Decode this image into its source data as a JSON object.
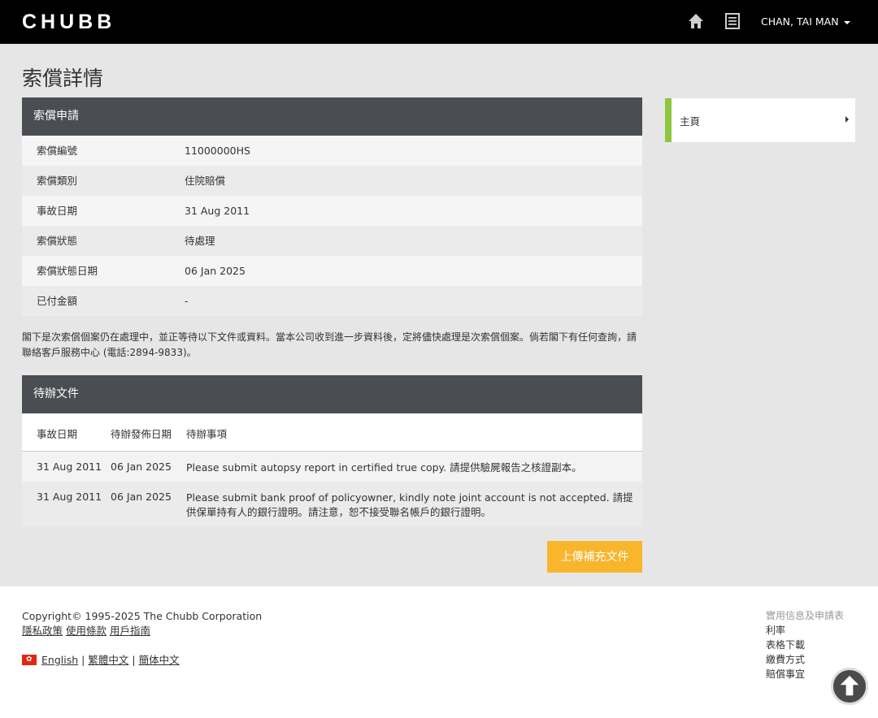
{
  "header": {
    "logo": "CHUBB",
    "user_name": "CHAN, TAI MAN",
    "icons": [
      "home-icon",
      "document-list-icon"
    ]
  },
  "page": {
    "title": "索償詳情"
  },
  "claim": {
    "heading": "索償申請",
    "rows": [
      {
        "label": "索償編號",
        "value": "11000000HS"
      },
      {
        "label": "索償類別",
        "value": "住院賠償"
      },
      {
        "label": "事故日期",
        "value": "31 Aug 2011"
      },
      {
        "label": "索償狀態",
        "value": "待處理"
      },
      {
        "label": "索償狀態日期",
        "value": "06 Jan 2025"
      },
      {
        "label": "已付金額",
        "value": "-"
      }
    ]
  },
  "notice": "閣下是次索償個案仍在處理中，並正等待以下文件或資料。當本公司收到進一步資料後，定將儘快處理是次索償個案。倘若閣下有任何查詢，請聯絡客戶服務中心 (電話:2894-9833)。",
  "pending": {
    "heading": "待辦文件",
    "columns": [
      "事故日期",
      "待辦發佈日期",
      "待辦事項"
    ],
    "rows": [
      {
        "incident_date": "31 Aug 2011",
        "issue_date": "06 Jan 2025",
        "item": "Please submit autopsy report in certified true copy. 請提供驗屍報告之核證副本。"
      },
      {
        "incident_date": "31 Aug 2011",
        "issue_date": "06 Jan 2025",
        "item": "Please submit bank proof of policyowner, kindly note joint account is not accepted. 請提供保單持有人的銀行證明。請注意，恕不接受聯名帳戶的銀行證明。"
      }
    ],
    "upload_label": "上傳補充文件"
  },
  "sidebar": {
    "items": [
      {
        "label": "主頁"
      }
    ],
    "accent": "#8dc63f"
  },
  "footer": {
    "copyright": "Copyright© 1995-2025 The Chubb Corporation",
    "links": [
      "隱私政策",
      "使用條款",
      "用戶指南"
    ],
    "languages": [
      "English",
      "繁體中文",
      "簡体中文"
    ],
    "right_heading": "實用信息及申請表",
    "right_links": [
      "利率",
      "表格下載",
      "繳費方式",
      "賠償事宜"
    ]
  },
  "colors": {
    "header_bg": "#000000",
    "panel_head": "#4a4d52",
    "upload_button": "#f9b52b"
  }
}
